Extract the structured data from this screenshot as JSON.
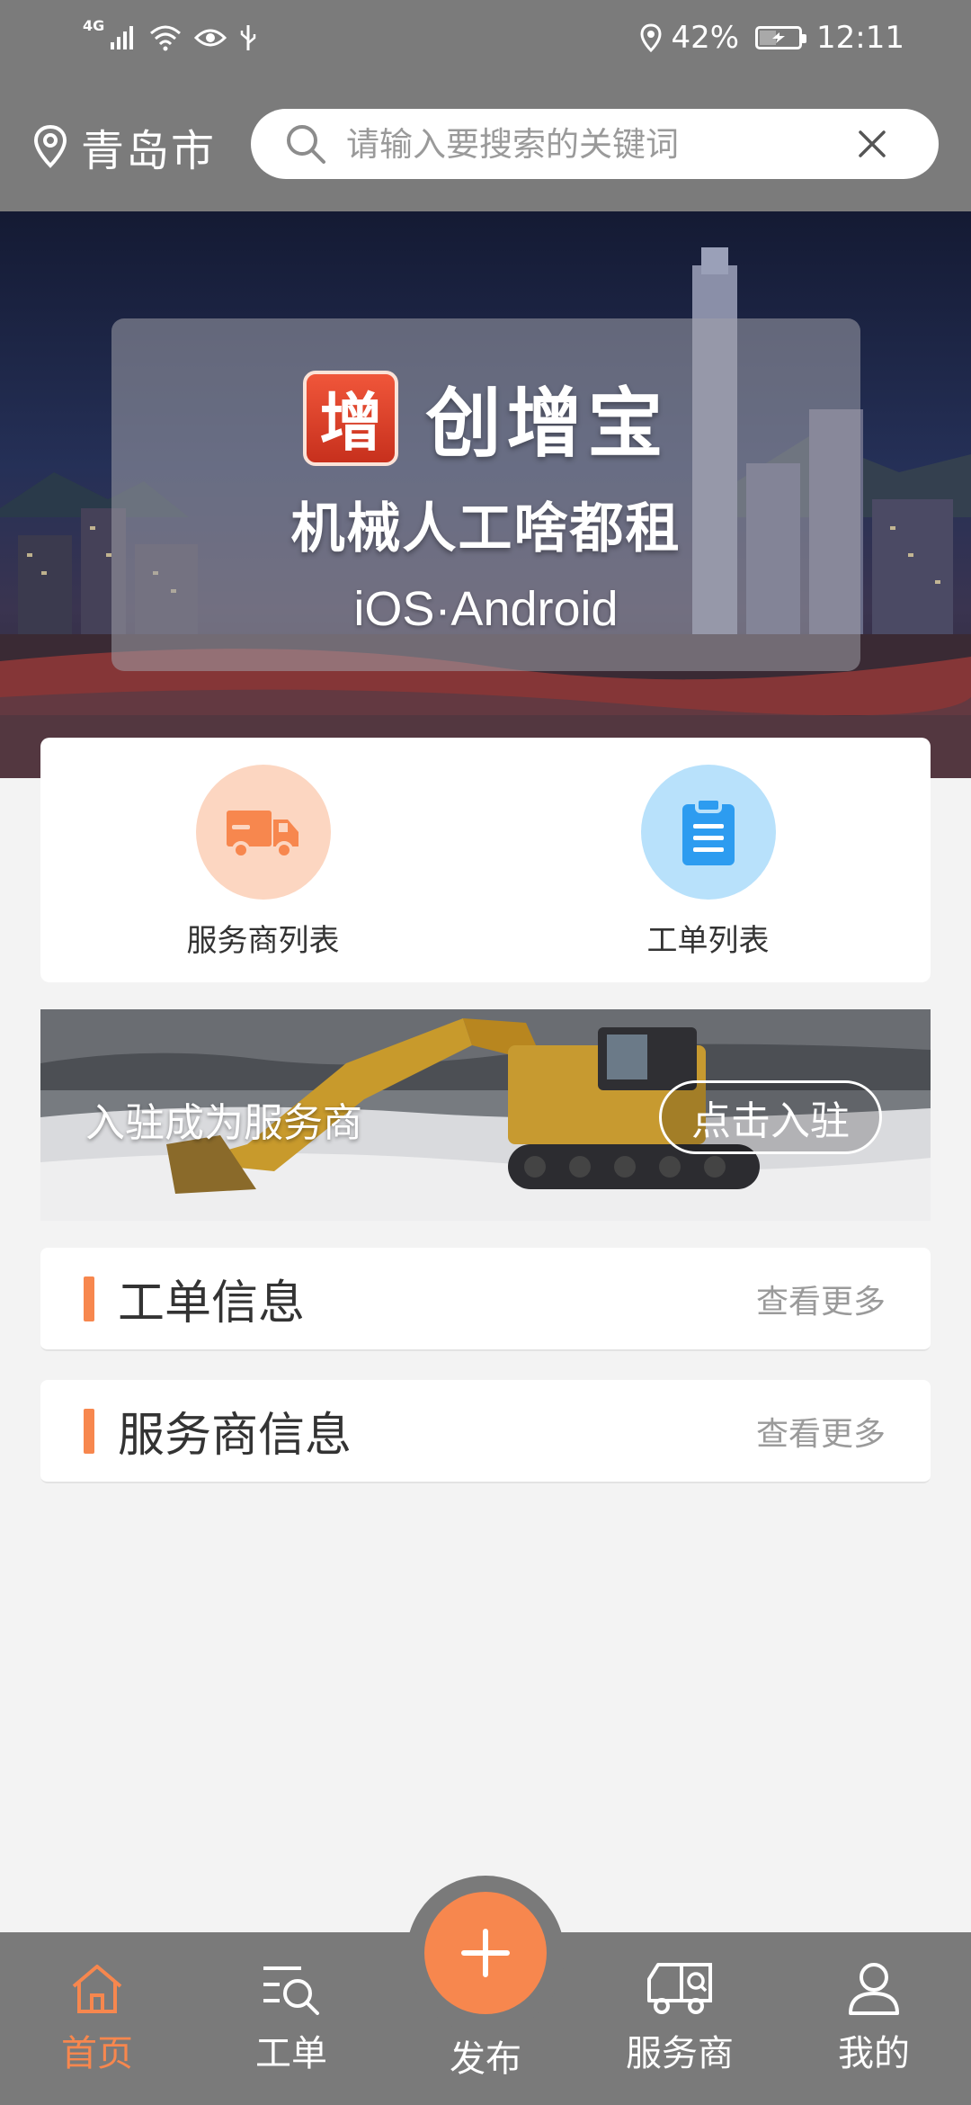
{
  "status_bar": {
    "network": "4G",
    "battery": "42%",
    "time": "12:11"
  },
  "header": {
    "city": "青岛市",
    "search_placeholder": "请输入要搜索的关键词"
  },
  "hero": {
    "brand_logo_char": "增",
    "brand_name": "创增宝",
    "slogan": "机械人工啥都租",
    "platforms": "iOS·Android"
  },
  "quick_actions": [
    {
      "label": "服务商列表",
      "icon": "truck-icon",
      "color": "#f7874e"
    },
    {
      "label": "工单列表",
      "icon": "clipboard-icon",
      "color": "#2d9cf0"
    }
  ],
  "join_banner": {
    "text": "入驻成为服务商",
    "button": "点击入驻"
  },
  "sections": [
    {
      "title": "工单信息",
      "more": "查看更多"
    },
    {
      "title": "服务商信息",
      "more": "查看更多"
    }
  ],
  "bottom_nav": {
    "items": [
      {
        "label": "首页",
        "icon": "home-icon",
        "active": true
      },
      {
        "label": "工单",
        "icon": "order-search-icon",
        "active": false
      },
      {
        "label": "发布",
        "icon": "plus-icon",
        "active": false
      },
      {
        "label": "服务商",
        "icon": "provider-truck-icon",
        "active": false
      },
      {
        "label": "我的",
        "icon": "user-icon",
        "active": false
      }
    ]
  },
  "colors": {
    "accent": "#f7874e",
    "header_bg": "#7b7b7b",
    "page_bg": "#f3f3f3",
    "blue": "#2d9cf0"
  }
}
